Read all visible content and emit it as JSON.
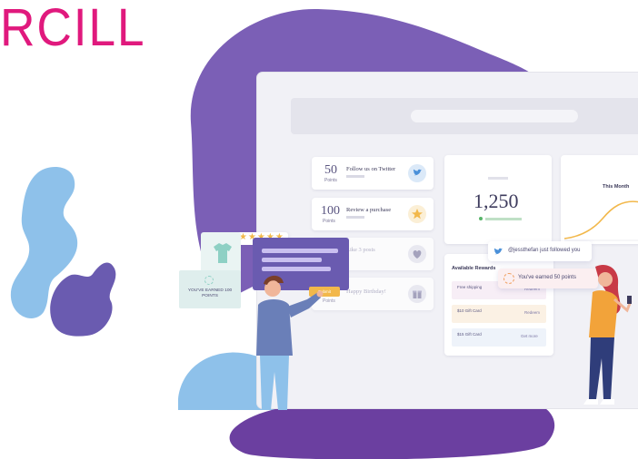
{
  "brand": {
    "wordmark": "RCILL",
    "color": "#e0197d"
  },
  "colors": {
    "purple": "#7b5fb6",
    "blue": "#8ec1ea",
    "accent": "#c98fd9"
  },
  "dashboard": {
    "actions": [
      {
        "points": "50",
        "points_label": "Points",
        "title": "Follow us on Twitter",
        "icon": "twitter-icon"
      },
      {
        "points": "100",
        "points_label": "Points",
        "title": "Review a purchase",
        "icon": "star-icon"
      },
      {
        "points": "",
        "points_label": "",
        "title": "Like 3 posts",
        "icon": "heart-icon"
      },
      {
        "points": "",
        "points_label": "Points",
        "title": "Happy Birthday!",
        "icon": "gift-icon"
      }
    ],
    "balance": {
      "value": "1,250"
    },
    "chart_card": {
      "title": "This Month"
    },
    "rewards": {
      "title": "Available Rewards",
      "items": [
        {
          "name": "Free shipping",
          "points": "",
          "action": "Redeem"
        },
        {
          "name": "$10 Gift Card",
          "points": "",
          "action": "Redeem"
        },
        {
          "name": "$15 Gift Card",
          "points": "",
          "action": "Get more"
        }
      ]
    }
  },
  "notifications": {
    "follow": "@jessthefan just followed you",
    "earned": "You've earned 50 points"
  },
  "floating": {
    "earned_card": "YOU'VE EARNED 100 POINTS",
    "submit": "Submit"
  }
}
